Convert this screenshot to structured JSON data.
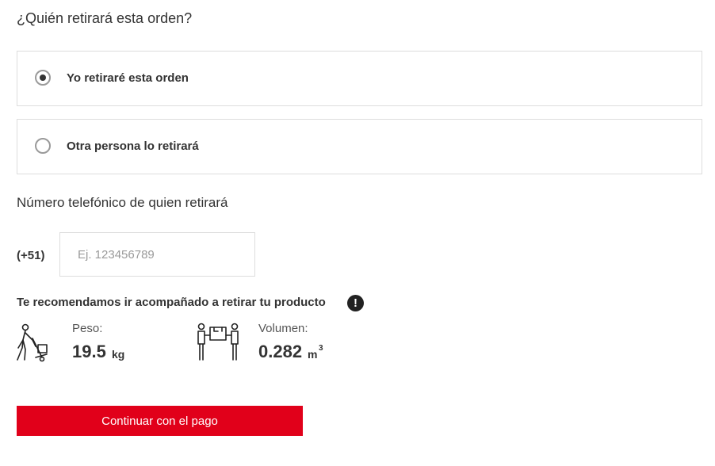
{
  "question": "¿Quién retirará esta orden?",
  "options": [
    {
      "label": "Yo retiraré esta orden",
      "selected": true
    },
    {
      "label": "Otra persona lo retirará",
      "selected": false
    }
  ],
  "phone": {
    "title": "Número telefónico de quien retirará",
    "prefix": "(+51)",
    "value": "",
    "placeholder": "Ej. 123456789"
  },
  "recommendation": {
    "text": "Te recomendamos ir acompañado a retirar tu producto",
    "alert_icon": "exclamation-circle-icon",
    "alert_glyph": "!"
  },
  "weight": {
    "icon": "person-hand-truck-icon",
    "label": "Peso:",
    "value": "19.5",
    "unit": "kg"
  },
  "volume": {
    "icon": "two-people-carrying-box-icon",
    "label": "Volumen:",
    "value": "0.282",
    "unit": "m",
    "unit_sup": "3"
  },
  "continue_label": "Continuar con el pago",
  "colors": {
    "accent": "#e1001a",
    "text": "#333333",
    "border": "#dddddd",
    "placeholder": "#9a9a9a"
  }
}
